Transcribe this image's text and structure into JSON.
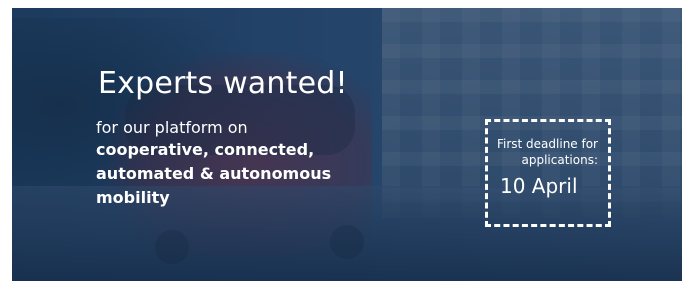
{
  "banner": {
    "title": "Experts wanted!",
    "lead": "for our platform on",
    "emphasis_lines": [
      "cooperative, connected,",
      "automated & autonomous",
      "mobility"
    ],
    "deadline": {
      "line1": "First deadline for",
      "line2": "applications:",
      "date": "10 April"
    },
    "colors": {
      "overlay": "#1f3f63",
      "text": "#ffffff",
      "accent": "#8f2a37"
    }
  }
}
